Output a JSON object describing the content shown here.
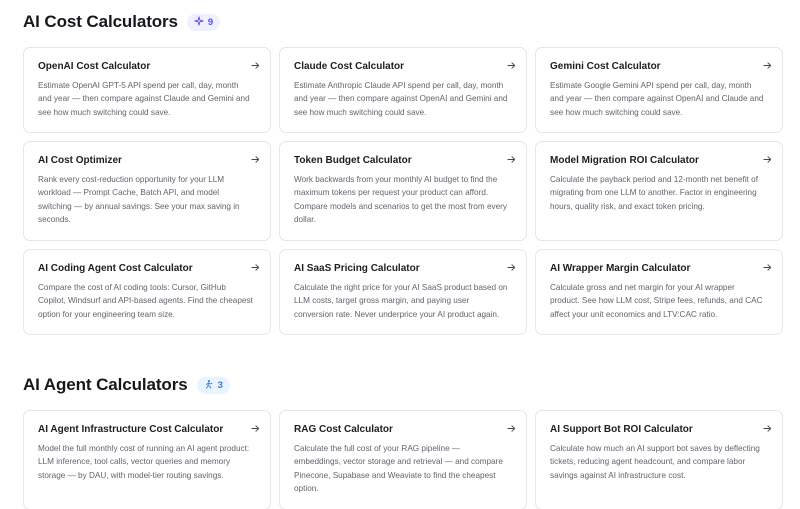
{
  "sections": [
    {
      "title": "AI Cost Calculators",
      "count": "9",
      "badge_icon": "sparkle-icon",
      "cards": [
        {
          "title": "OpenAI Cost Calculator",
          "desc": "Estimate OpenAI GPT-5 API spend per call, day, month and year — then compare against Claude and Gemini and see how much switching could save."
        },
        {
          "title": "Claude Cost Calculator",
          "desc": "Estimate Anthropic Claude API spend per call, day, month and year — then compare against OpenAI and Gemini and see how much switching could save."
        },
        {
          "title": "Gemini Cost Calculator",
          "desc": "Estimate Google Gemini API spend per call, day, month and year — then compare against OpenAI and Claude and see how much switching could save."
        },
        {
          "title": "AI Cost Optimizer",
          "desc": "Rank every cost-reduction opportunity for your LLM workload — Prompt Cache, Batch API, and model switching — by annual savings. See your max saving in seconds."
        },
        {
          "title": "Token Budget Calculator",
          "desc": "Work backwards from your monthly AI budget to find the maximum tokens per request your product can afford. Compare models and scenarios to get the most from every dollar."
        },
        {
          "title": "Model Migration ROI Calculator",
          "desc": "Calculate the payback period and 12-month net benefit of migrating from one LLM to another. Factor in engineering hours, quality risk, and exact token pricing."
        },
        {
          "title": "AI Coding Agent Cost Calculator",
          "desc": "Compare the cost of AI coding tools: Cursor, GitHub Copilot, Windsurf and API-based agents. Find the cheapest option for your engineering team size."
        },
        {
          "title": "AI SaaS Pricing Calculator",
          "desc": "Calculate the right price for your AI SaaS product based on LLM costs, target gross margin, and paying user conversion rate. Never underprice your AI product again."
        },
        {
          "title": "AI Wrapper Margin Calculator",
          "desc": "Calculate gross and net margin for your AI wrapper product. See how LLM cost, Stripe fees, refunds, and CAC affect your unit economics and LTV:CAC ratio."
        }
      ]
    },
    {
      "title": "AI Agent Calculators",
      "count": "3",
      "badge_icon": "agent-icon",
      "cards": [
        {
          "title": "AI Agent Infrastructure Cost Calculator",
          "desc": "Model the full monthly cost of running an AI agent product: LLM inference, tool calls, vector queries and memory storage — by DAU, with model-tier routing savings."
        },
        {
          "title": "RAG Cost Calculator",
          "desc": "Calculate the full cost of your RAG pipeline — embeddings, vector storage and retrieval — and compare Pinecone, Supabase and Weaviate to find the cheapest option."
        },
        {
          "title": "AI Support Bot ROI Calculator",
          "desc": "Calculate how much an AI support bot saves by deflecting tickets, reducing agent headcount, and compare labor savings against AI infrastructure cost."
        }
      ]
    }
  ]
}
